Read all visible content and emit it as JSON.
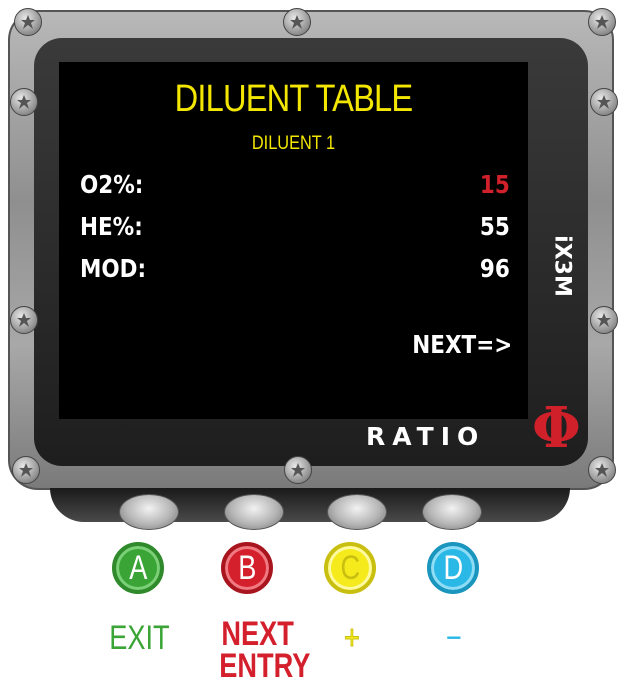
{
  "device": {
    "model": "iX3M",
    "brand": "RATIO",
    "brand_logo": "phi-logo",
    "accent_colors": {
      "title": "#f3e600",
      "highlight": "#d0202a"
    }
  },
  "screen": {
    "title": "DILUENT TABLE",
    "subtitle": "DILUENT 1",
    "rows": [
      {
        "label": "O2%:",
        "value": "15",
        "highlighted": true
      },
      {
        "label": "HE%:",
        "value": "55",
        "highlighted": false
      },
      {
        "label": "MOD:",
        "value": "96",
        "highlighted": false
      }
    ],
    "next_label": "NEXT=>"
  },
  "buttons": [
    {
      "letter": "A",
      "action": "EXIT",
      "color": "#3aa536"
    },
    {
      "letter": "B",
      "action": "NEXT\nENTRY",
      "color": "#d41f2c"
    },
    {
      "letter": "C",
      "action": "+",
      "color": "#f4ea1c"
    },
    {
      "letter": "D",
      "action": "−",
      "color": "#2ab8e6"
    }
  ]
}
